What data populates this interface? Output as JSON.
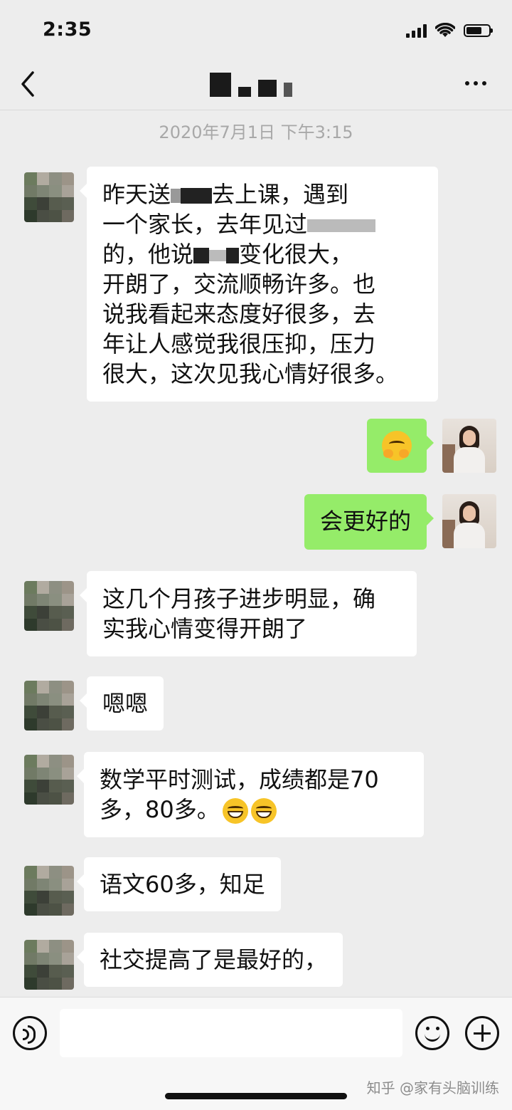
{
  "status_bar": {
    "time": "2:35",
    "icons": [
      "signal-icon",
      "wifi-icon",
      "battery-icon"
    ],
    "battery_level": 0.7
  },
  "nav": {
    "back_icon": "chevron-left-icon",
    "more_icon": "more-dots-icon"
  },
  "timestamp": "2020年7月1日 下午3:15",
  "messages": [
    {
      "side": "left",
      "lines": [
        {
          "before": "昨天送",
          "after": "去上课，遇到"
        },
        {
          "before": "一个家长，去年见过",
          "after": ""
        },
        {
          "before": "的，他说",
          "after": "变化很大，"
        },
        {
          "before": "开朗了，交流顺畅许多。也",
          "after": ""
        },
        {
          "before": "说我看起来态度好很多，去",
          "after": ""
        },
        {
          "before": "年让人感觉我很压抑，压力",
          "after": ""
        },
        {
          "before": "很大，这次见我心情好很多。",
          "after": ""
        }
      ]
    },
    {
      "side": "right",
      "emoji": "hugging-face-emoji-icon"
    },
    {
      "side": "right",
      "text": "会更好的"
    },
    {
      "side": "left",
      "lines": [
        "这几个月孩子进步明显，确",
        "实我心情变得开朗了"
      ]
    },
    {
      "side": "left",
      "text": "嗯嗯"
    },
    {
      "side": "left",
      "lines": [
        "数学平时测试，成绩都是70",
        "多，80多。"
      ],
      "emoji": "grinning-face-emoji-icon"
    },
    {
      "side": "left",
      "text": "语文60多，知足"
    },
    {
      "side": "left",
      "text": "社交提高了是最好的，"
    }
  ],
  "input_bar": {
    "icons": [
      "voice-icon",
      "emoji-icon",
      "plus-icon"
    ]
  },
  "watermark": "知乎 @家有头脑训练",
  "colors": {
    "background": "#ededed",
    "bubble_self": "#95ec69",
    "bubble_other": "#ffffff",
    "timestamp": "#a8a8a8"
  }
}
